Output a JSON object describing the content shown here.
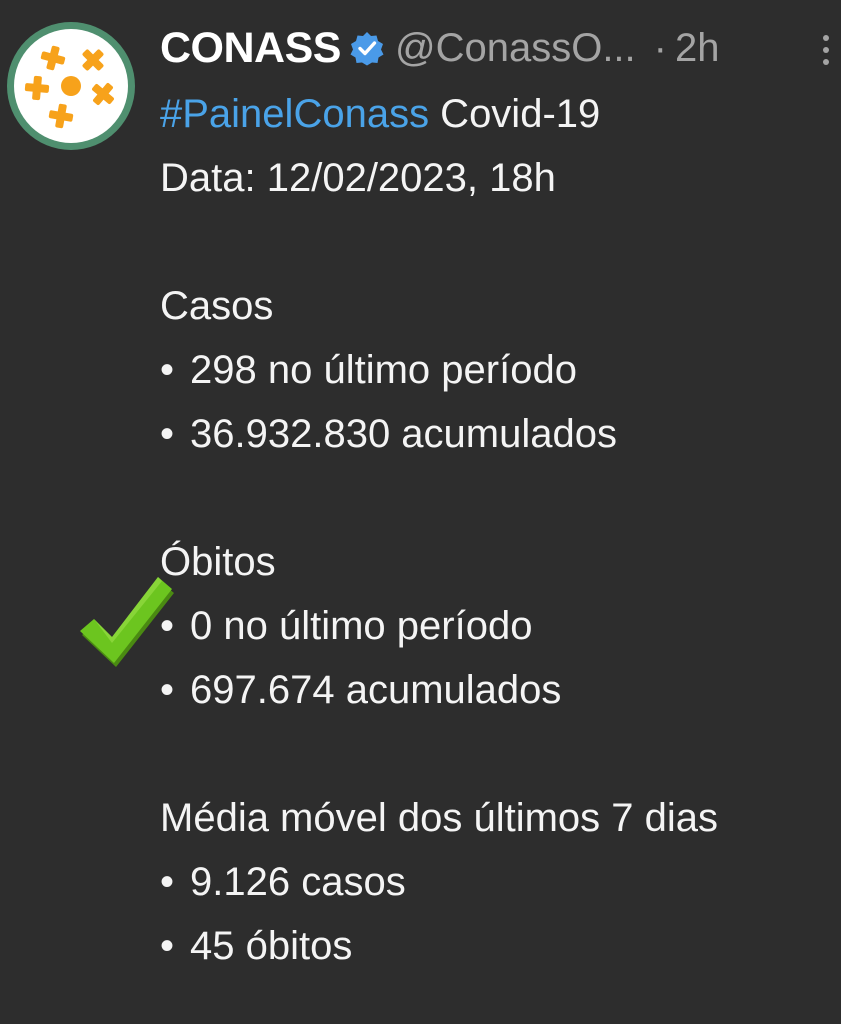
{
  "account": {
    "display_name": "CONASS",
    "handle": "@ConassO...",
    "separator": "·",
    "time": "2h"
  },
  "post": {
    "hashtag": "#PainelConass",
    "title_rest": " Covid-19",
    "date_line": "Data: 12/02/2023, 18h",
    "sections": [
      {
        "heading": "Casos",
        "items": [
          "298 no último período",
          "36.932.830 acumulados"
        ]
      },
      {
        "heading": "Óbitos",
        "items": [
          "0 no último período",
          "697.674 acumulados"
        ]
      },
      {
        "heading": "Média móvel dos últimos 7 dias",
        "items": [
          "9.126 casos",
          "45 óbitos"
        ]
      }
    ]
  },
  "icons": {
    "avatar": "conass-logo-icon",
    "verified": "verified-badge-icon",
    "more": "more-options-icon",
    "check": "green-check-icon"
  },
  "colors": {
    "background": "#2d2d2d",
    "hashtag": "#4aa3e8",
    "verified": "#4a9ae8",
    "logo_orange": "#f7a21b",
    "logo_ring": "#4f8f6f",
    "check_green": "#6cc51f"
  }
}
